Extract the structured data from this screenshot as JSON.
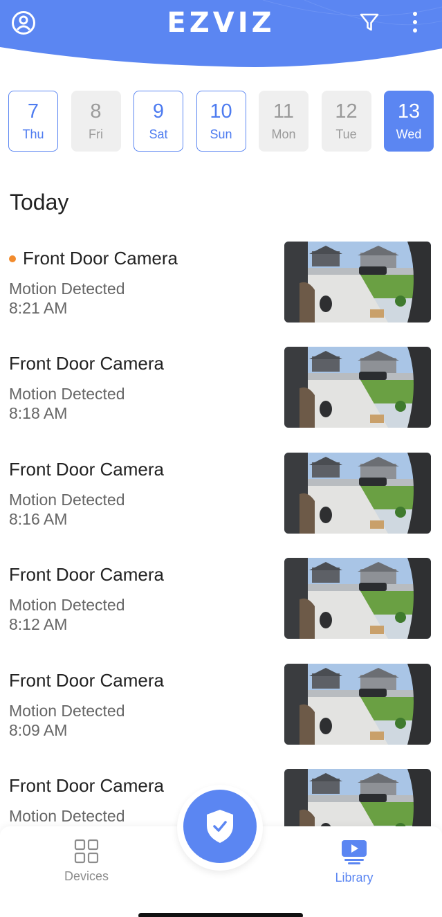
{
  "header": {
    "logo": "EZVIZ",
    "icons": {
      "profile": "person-circle-icon",
      "filter": "filter-icon",
      "more": "more-vertical-icon"
    },
    "color": "#5b86f2"
  },
  "dates": [
    {
      "num": "7",
      "dow": "Thu",
      "state": "active"
    },
    {
      "num": "8",
      "dow": "Fri",
      "state": "inactive"
    },
    {
      "num": "9",
      "dow": "Sat",
      "state": "active"
    },
    {
      "num": "10",
      "dow": "Sun",
      "state": "active"
    },
    {
      "num": "11",
      "dow": "Mon",
      "state": "inactive"
    },
    {
      "num": "12",
      "dow": "Tue",
      "state": "inactive"
    },
    {
      "num": "13",
      "dow": "Wed",
      "state": "selected"
    }
  ],
  "section_title": "Today",
  "events": [
    {
      "camera": "Front Door Camera",
      "type": "Motion Detected",
      "time": "8:21 AM",
      "unread": true
    },
    {
      "camera": "Front Door Camera",
      "type": "Motion Detected",
      "time": "8:18 AM",
      "unread": false
    },
    {
      "camera": "Front Door Camera",
      "type": "Motion Detected",
      "time": "8:16 AM",
      "unread": false
    },
    {
      "camera": "Front Door Camera",
      "type": "Motion Detected",
      "time": "8:12 AM",
      "unread": false
    },
    {
      "camera": "Front Door Camera",
      "type": "Motion Detected",
      "time": "8:09 AM",
      "unread": false
    },
    {
      "camera": "Front Door Camera",
      "type": "Motion Detected",
      "time": "",
      "unread": false
    }
  ],
  "tabbar": {
    "devices": {
      "label": "Devices",
      "icon": "grid-icon",
      "color": "#8c8c8c"
    },
    "library": {
      "label": "Library",
      "icon": "play-library-icon",
      "color": "#5b86f2"
    },
    "center": {
      "icon": "shield-check-icon"
    }
  },
  "colors": {
    "accent": "#5b86f2",
    "unread_dot": "#f28b2d"
  }
}
